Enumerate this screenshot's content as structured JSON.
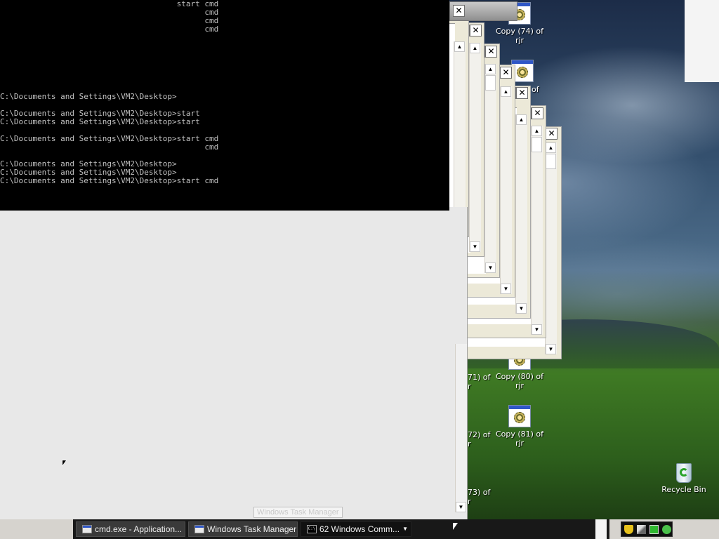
{
  "console": {
    "lines": [
      "                                      start cmd",
      "                                            cmd",
      "                                            cmd",
      "                                            cmd",
      "",
      "",
      "",
      "",
      "",
      "",
      "",
      "C:\\Documents and Settings\\VM2\\Desktop>",
      "",
      "C:\\Documents and Settings\\VM2\\Desktop>start",
      "C:\\Documents and Settings\\VM2\\Desktop>start",
      "",
      "C:\\Documents and Settings\\VM2\\Desktop>start cmd",
      "                                            cmd",
      "",
      "C:\\Documents and Settings\\VM2\\Desktop>",
      "C:\\Documents and Settings\\VM2\\Desktop>",
      "C:\\Documents and Settings\\VM2\\Desktop>start cmd"
    ]
  },
  "window_buttons": {
    "close": "✕",
    "maximize": "□",
    "minimize": "–",
    "scroll_up": "▲",
    "scroll_down": "▼"
  },
  "desktop_icons": {
    "copy74": {
      "line1": "Copy (74) of",
      "line2": "rjr"
    },
    "copy80": {
      "line1": "Copy (80) of",
      "line2": "rjr"
    },
    "copy81": {
      "line1": "Copy (81) of",
      "line2": "rjr"
    },
    "partial_of": "of",
    "partial71": "71) of",
    "partial72": "72) of",
    "partial73": "73) of",
    "partial_r": "r",
    "recycle_bin": "Recycle Bin"
  },
  "ghost_tooltip": "Windows Task Manager",
  "taskbar": {
    "tasks": [
      {
        "label": "cmd.exe - Application..."
      },
      {
        "label": "Windows Task Manager"
      },
      {
        "label": "62 Windows Comm...",
        "dropdown": "▼"
      }
    ],
    "console_icon_text": "C:\\"
  }
}
